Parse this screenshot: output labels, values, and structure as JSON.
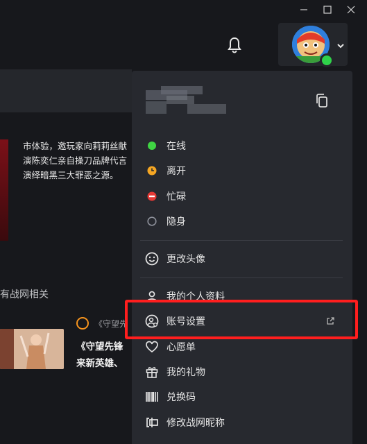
{
  "window_controls": {
    "minimize_icon": "minimize-icon",
    "maximize_icon": "maximize-icon",
    "close_icon": "close-icon"
  },
  "header": {
    "bell_icon": "bell-icon",
    "avatar_status_color": "#2fd24a"
  },
  "background": {
    "news_lines": [
      "市体验，邀玩家向莉莉丝献",
      "演陈奕仁亲自操刀品牌代言",
      "演绎暗黑三大罪恶之源。"
    ],
    "section_title": "有战网相关",
    "article_source": "《守望先",
    "article_title_lines": [
      "《守望先锋",
      "来新英雄、"
    ]
  },
  "menu": {
    "statuses": [
      {
        "label": "在线",
        "color": "#3fd443"
      },
      {
        "label": "离开",
        "color": "#f5a623"
      },
      {
        "label": "忙碌",
        "color": "#e53935"
      },
      {
        "label": "隐身",
        "color": "#6b6e78"
      }
    ],
    "change_avatar": "更改头像",
    "profile": "我的个人资料",
    "account_settings": "账号设置",
    "wishlist": "心愿单",
    "gifts": "我的礼物",
    "redeem": "兑换码",
    "change_battletag": "修改战网昵称"
  },
  "highlight_color": "#ff1e1e"
}
